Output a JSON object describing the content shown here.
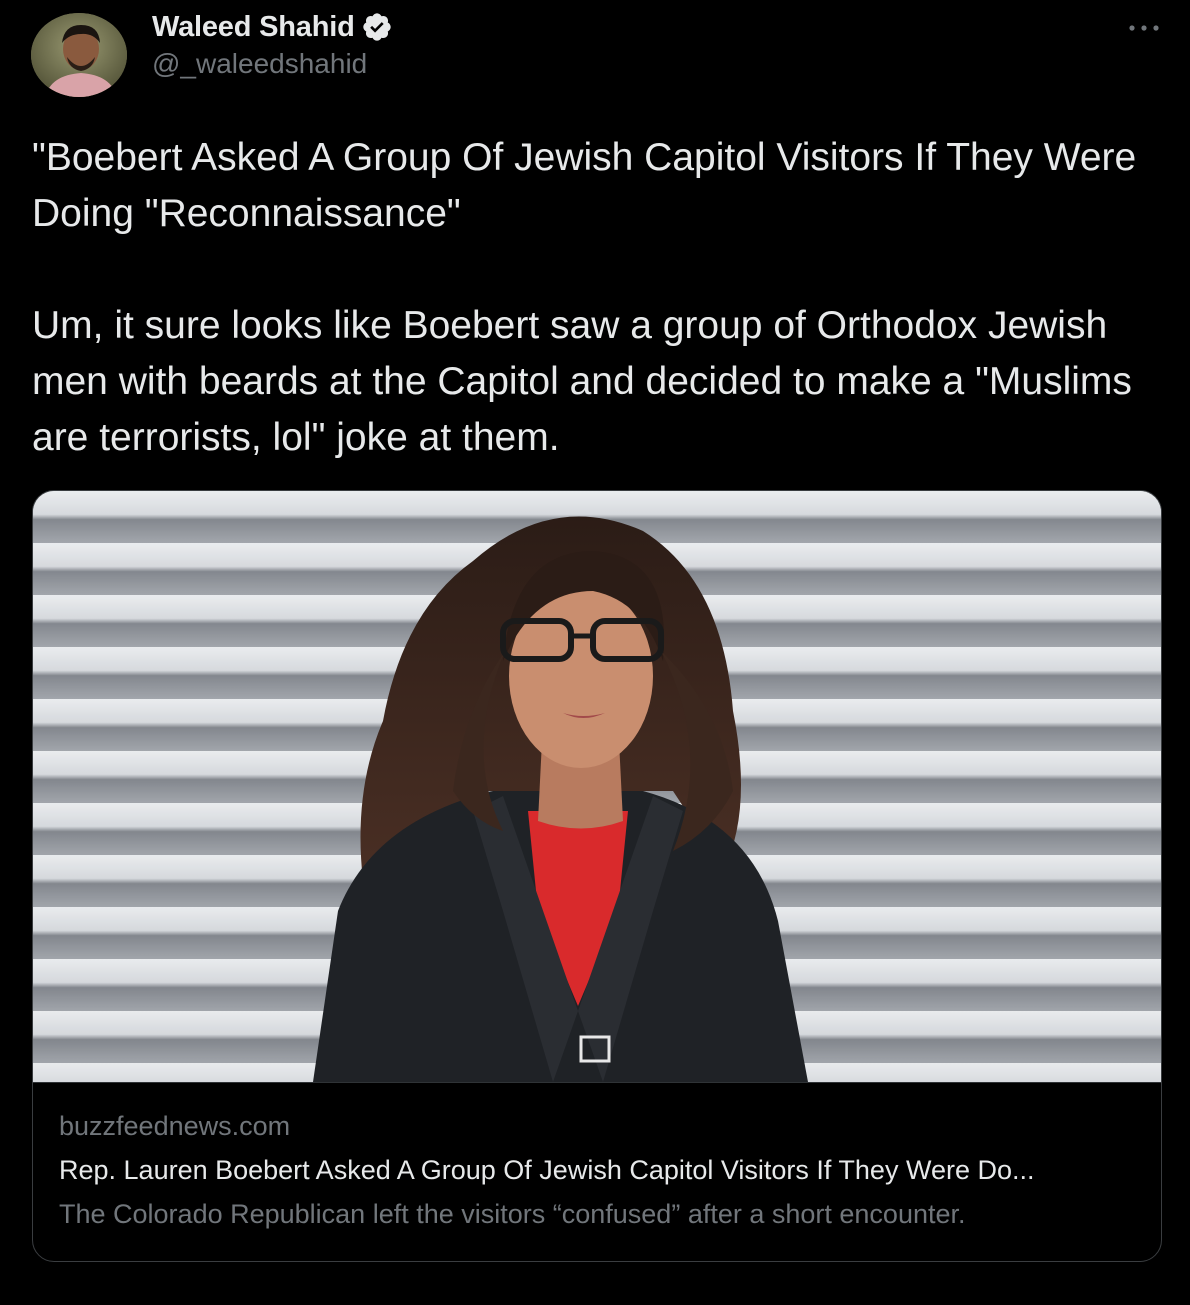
{
  "author": {
    "name": "Waleed Shahid",
    "handle": "@_waleedshahid",
    "verified": true
  },
  "tweet": {
    "text": "\"Boebert Asked A Group Of Jewish Capitol Visitors If They Were Doing \"Reconnaissance\"\n\nUm, it sure looks like Boebert saw a group of Orthodox Jewish men with beards at the Capitol and decided to make a \"Muslims are terrorists, lol\" joke at them."
  },
  "card": {
    "domain": "buzzfeednews.com",
    "title": "Rep. Lauren Boebert Asked A Group Of Jewish Capitol Visitors If They Were Do...",
    "description": "The Colorado Republican left the visitors “confused” after a short encounter."
  },
  "icons": {
    "verified": "verified-badge-icon",
    "more": "more-options-icon"
  },
  "colors": {
    "background": "#000000",
    "primary_text": "#e7e9ea",
    "secondary_text": "#71767b",
    "border": "#3a3d40",
    "verified_badge": "#e7e9ea"
  }
}
